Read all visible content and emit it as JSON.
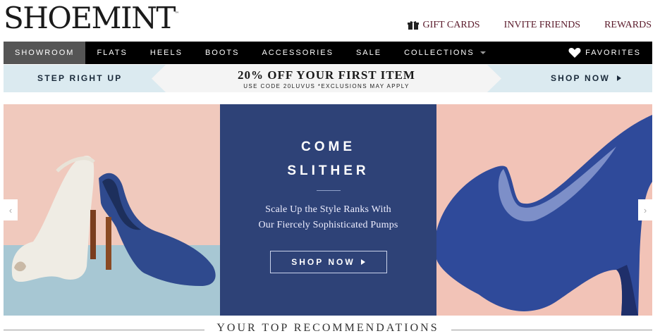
{
  "brand": {
    "logo": "SHOEMINT",
    "trademark": "™"
  },
  "header_links": [
    {
      "label": "GIFT CARDS",
      "icon": "gift-icon"
    },
    {
      "label": "INVITE FRIENDS"
    },
    {
      "label": "REWARDS"
    }
  ],
  "nav": {
    "items": [
      "SHOWROOM",
      "FLATS",
      "HEELS",
      "BOOTS",
      "ACCESSORIES",
      "SALE",
      "COLLECTIONS"
    ],
    "active": "SHOWROOM",
    "favorites": "FAVORITES"
  },
  "promo": {
    "left": "STEP RIGHT UP",
    "headline": "20% OFF YOUR FIRST ITEM",
    "subline": "USE CODE 20LUVUS *EXCLUSIONS MAY APPLY",
    "cta": "SHOP NOW"
  },
  "hero": {
    "title_line1": "COME",
    "title_line2": "SLITHER",
    "desc_line1": "Scale Up the Style Ranks With",
    "desc_line2": "Our Fiercely Sophisticated Pumps",
    "cta": "SHOP NOW",
    "prev_arrow": "‹",
    "next_arrow": "›"
  },
  "recommendations": {
    "title": "YOUR TOP RECOMMENDATIONS"
  },
  "colors": {
    "nav_bg": "#000000",
    "promo_bg": "#dbeaf0",
    "hero_blue": "#2e4277",
    "hero_pink": "#f0c9bd",
    "link_color": "#5a1a2a"
  }
}
